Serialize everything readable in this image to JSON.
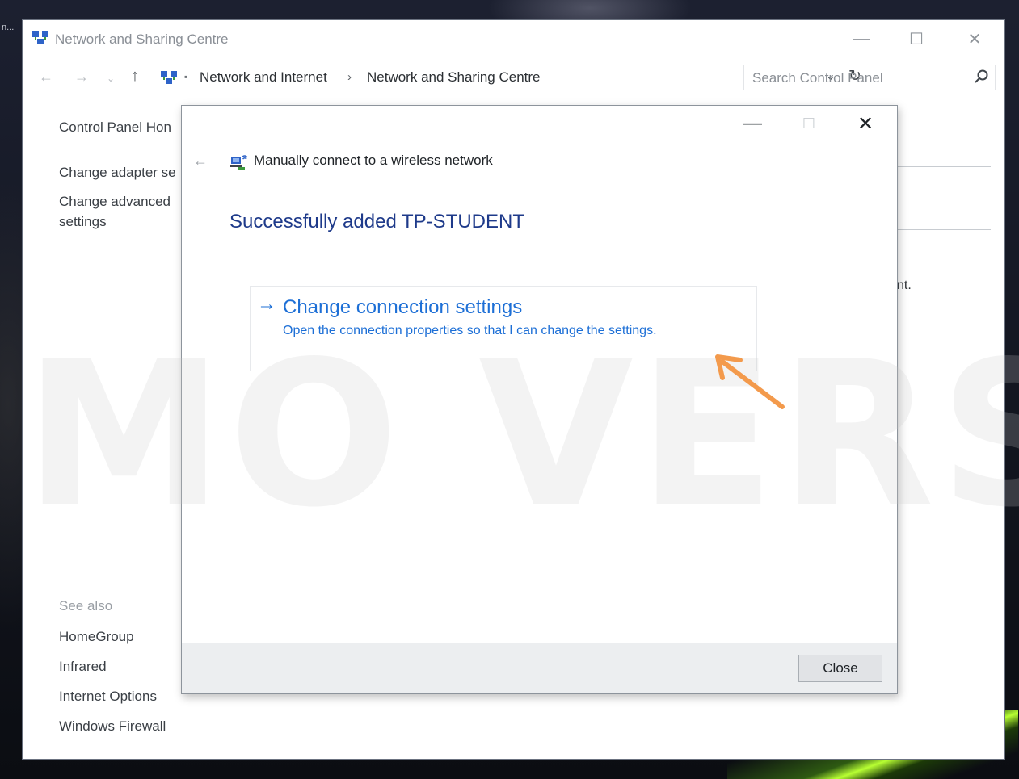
{
  "desktop": {
    "left_tag": "n..."
  },
  "window": {
    "title": "Network and Sharing Centre",
    "address": {
      "crumbs": [
        "Network and Internet",
        "Network and Sharing Centre"
      ]
    },
    "search": {
      "placeholder": "Search Control Panel"
    },
    "sidebar": {
      "links": [
        "Control Panel Hon",
        "Change adapter se",
        "Change advanced",
        "settings"
      ],
      "see_also_label": "See also",
      "see_also_links": [
        "HomeGroup",
        "Infrared",
        "Internet Options",
        "Windows Firewall"
      ]
    },
    "background_fragment": "nt."
  },
  "watermark": "MO VERSI",
  "dialog": {
    "title": "Manually connect to a wireless network",
    "heading": "Successfully added TP-STUDENT",
    "task": {
      "title": "Change connection settings",
      "description": "Open the connection properties so that I can change the settings."
    },
    "close_label": "Close"
  },
  "icons": {
    "minimize": "minimize-icon",
    "maximize": "maximize-icon",
    "close": "close-icon",
    "back": "back-arrow-icon",
    "forward": "forward-arrow-icon",
    "up": "up-arrow-icon",
    "refresh": "refresh-icon",
    "search": "search-icon",
    "network": "network-icon",
    "task_arrow": "right-arrow-icon",
    "annotation": "annotation-arrow-icon"
  },
  "colors": {
    "link_blue": "#1d6fd6",
    "heading_blue": "#1e3a8a",
    "annotation_orange": "#f39a4c"
  }
}
